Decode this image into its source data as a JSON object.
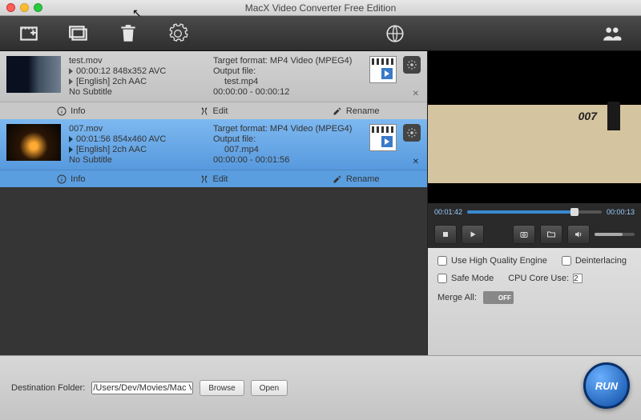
{
  "window": {
    "title": "MacX Video Converter Free Edition"
  },
  "items": [
    {
      "filename": "test.mov",
      "video_line": "00:00:12 848x352 AVC",
      "audio_line": "[English] 2ch AAC",
      "subtitle_line": "No Subtitle",
      "target_format": "Target format: MP4 Video (MPEG4)",
      "output_label": "Output file:",
      "output_file": "test.mp4",
      "time_range": "00:00:00 - 00:00:12"
    },
    {
      "filename": "007.mov",
      "video_line": "00:01:56 854x460 AVC",
      "audio_line": "[English] 2ch AAC",
      "subtitle_line": "No Subtitle",
      "target_format": "Target format: MP4 Video (MPEG4)",
      "output_label": "Output file:",
      "output_file": "007.mp4",
      "time_range": "00:00:00 - 00:01:56"
    }
  ],
  "subbar": {
    "info": "Info",
    "edit": "Edit",
    "rename": "Rename"
  },
  "preview": {
    "elapsed": "00:01:42",
    "remaining": "00:00:13",
    "logo": "007"
  },
  "options": {
    "hq": "Use High Quality Engine",
    "deint": "Deinterlacing",
    "safe": "Safe Mode",
    "cpu_label": "CPU Core Use:",
    "cpu_value": "2",
    "merge_label": "Merge All:",
    "merge_state": "OFF"
  },
  "dest": {
    "label": "Destination Folder:",
    "path": "/Users/Dev/Movies/Mac Video Library",
    "browse": "Browse",
    "open": "Open"
  },
  "run": "RUN"
}
